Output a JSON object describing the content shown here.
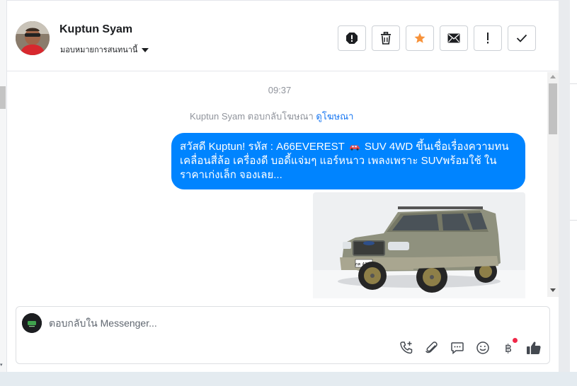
{
  "contact": {
    "name": "Kuptun Syam",
    "assign_label": "มอบหมายการสนทนานี้"
  },
  "header_actions": [
    {
      "name": "report-icon",
      "label": "Report"
    },
    {
      "name": "trash-icon",
      "label": "Delete"
    },
    {
      "name": "star-icon",
      "label": "Star"
    },
    {
      "name": "mail-icon",
      "label": "Mark as unread"
    },
    {
      "name": "exclamation-icon",
      "label": "Follow up"
    },
    {
      "name": "checkmark-icon",
      "label": "Mark as done"
    }
  ],
  "conversation": {
    "timestamp": "09:37",
    "reply_note_prefix": "Kuptun Syam ตอบกลับโฆษณา ",
    "reply_note_link": "ดูโฆษณา",
    "message_part1": "สวัสดี Kuptun!  รหัส : A66EVEREST ",
    "message_part2": " SUV 4WD ขึ้นเชื่อเรื่องความทน เคลื่อนสี่ล้อ เครื่องดี บอดี้แจ่มๆ  แอร์หนาว เพลงเพราะ SUVพร้อมใช้ ใน ราคาเก่งเล็ก จองเลย...",
    "photo_plate": "ภค 4109"
  },
  "composer": {
    "placeholder": "ตอบกลับใน Messenger...",
    "tools": [
      "phone-add-icon",
      "paperclip-icon",
      "saved-reply-icon",
      "emoji-icon",
      "baht-payment-icon",
      "thumbs-up-icon"
    ],
    "baht_symbol": "฿"
  },
  "colors": {
    "bubble": "#0084ff",
    "link": "#1877f2",
    "star": "#f7923a",
    "notification_dot": "#f02849"
  }
}
